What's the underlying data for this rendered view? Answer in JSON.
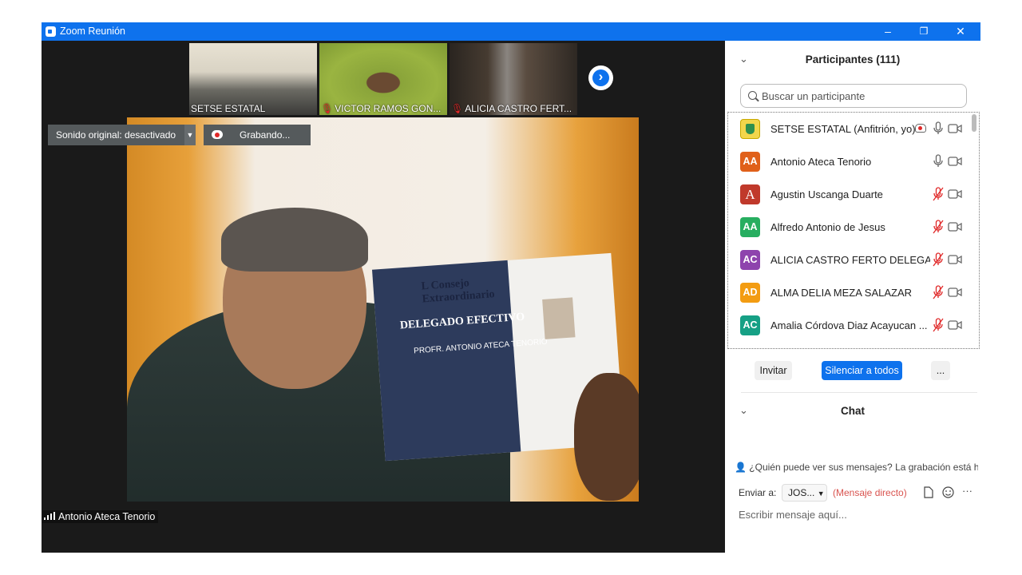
{
  "window": {
    "title": "Zoom Reunión",
    "controls": [
      "–",
      "❐",
      "✕"
    ]
  },
  "thumbnails": [
    {
      "name": "SETSE ESTATAL",
      "muted": false
    },
    {
      "name": "VICTOR RAMOS GON...",
      "muted": true
    },
    {
      "name": "ALICIA CASTRO FERT...",
      "muted": true
    }
  ],
  "overlay": {
    "original_sound": "Sonido original: desactivado",
    "recording": "Grabando..."
  },
  "active_speaker": "Antonio Ateca Tenorio",
  "card": {
    "line1": "L Consejo",
    "line2": "Extraordinario",
    "role": "DELEGADO EFECTIVO",
    "holder": "PROFR. ANTONIO ATECA TENORIO"
  },
  "participants_panel": {
    "title": "Participantes (111)",
    "search_placeholder": "Buscar un participante",
    "participants": [
      {
        "initials": "",
        "name": "SETSE ESTATAL (Anfitrión, yo)",
        "color": "#f2d64b",
        "muted": false,
        "recording": true
      },
      {
        "initials": "AA",
        "name": "Antonio Ateca Tenorio",
        "color": "#e0601a",
        "muted": false,
        "recording": false
      },
      {
        "initials": "A",
        "name": "Agustin Uscanga Duarte",
        "color": "#c0392b",
        "muted": true,
        "recording": false
      },
      {
        "initials": "AA",
        "name": "Alfredo Antonio de Jesus",
        "color": "#27ae60",
        "muted": true,
        "recording": false
      },
      {
        "initials": "AC",
        "name": "ALICIA CASTRO FERTO DELEGAC...",
        "color": "#8e44ad",
        "muted": true,
        "recording": false
      },
      {
        "initials": "AD",
        "name": "ALMA DELIA MEZA SALAZAR",
        "color": "#f39c12",
        "muted": true,
        "recording": false
      },
      {
        "initials": "AC",
        "name": "Amalia Córdova Diaz Acayucan ...",
        "color": "#16a085",
        "muted": true,
        "recording": false
      }
    ],
    "buttons": {
      "invite": "Invitar",
      "mute_all": "Silenciar a todos",
      "more": "..."
    }
  },
  "chat": {
    "title": "Chat",
    "notice": "¿Quién puede ver sus mensajes? La grabación está habilitada",
    "send_to_label": "Enviar a:",
    "recipient": "JOS...",
    "direct_message": "(Mensaje directo)",
    "input_placeholder": "Escribir mensaje aquí..."
  }
}
